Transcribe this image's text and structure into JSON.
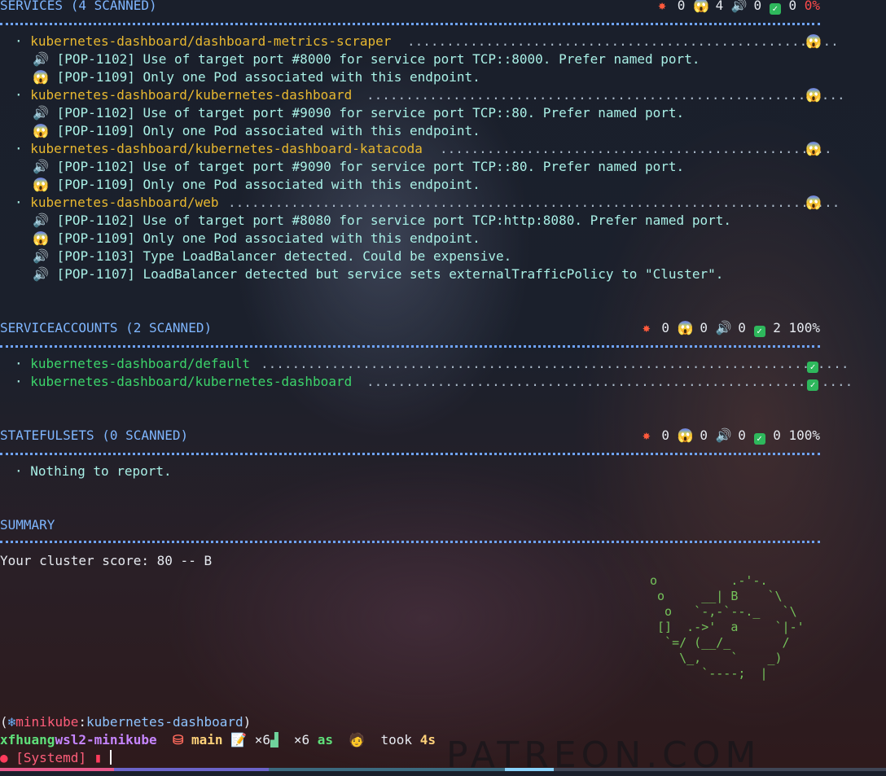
{
  "sections": [
    {
      "title": "SERVICES (4 SCANNED)",
      "stats": {
        "errors": "0",
        "warnings": "4",
        "infos": "0",
        "ok": "0",
        "score": "0%"
      },
      "items": [
        {
          "name": "kubernetes-dashboard/dashboard-metrics-scraper",
          "status": "warning",
          "messages": [
            {
              "level": "info",
              "text": "[POP-1102] Use of target port #8000 for service port TCP::8000. Prefer named port."
            },
            {
              "level": "warning",
              "text": "[POP-1109] Only one Pod associated with this endpoint."
            }
          ]
        },
        {
          "name": "kubernetes-dashboard/kubernetes-dashboard",
          "status": "warning",
          "messages": [
            {
              "level": "info",
              "text": "[POP-1102] Use of target port #9090 for service port TCP::80. Prefer named port."
            },
            {
              "level": "warning",
              "text": "[POP-1109] Only one Pod associated with this endpoint."
            }
          ]
        },
        {
          "name": "kubernetes-dashboard/kubernetes-dashboard-katacoda",
          "status": "warning",
          "messages": [
            {
              "level": "info",
              "text": "[POP-1102] Use of target port #9090 for service port TCP::80. Prefer named port."
            },
            {
              "level": "warning",
              "text": "[POP-1109] Only one Pod associated with this endpoint."
            }
          ]
        },
        {
          "name": "kubernetes-dashboard/web",
          "status": "warning",
          "messages": [
            {
              "level": "info",
              "text": "[POP-1102] Use of target port #8080 for service port TCP:http:8080. Prefer named port."
            },
            {
              "level": "warning",
              "text": "[POP-1109] Only one Pod associated with this endpoint."
            },
            {
              "level": "info",
              "text": "[POP-1103] Type LoadBalancer detected. Could be expensive."
            },
            {
              "level": "info",
              "text": "[POP-1107] LoadBalancer detected but service sets externalTrafficPolicy to \"Cluster\"."
            }
          ]
        }
      ]
    },
    {
      "title": "SERVICEACCOUNTS (2 SCANNED)",
      "stats": {
        "errors": "0",
        "warnings": "0",
        "infos": "0",
        "ok": "2",
        "score": "100%"
      },
      "items": [
        {
          "name": "kubernetes-dashboard/default",
          "status": "ok",
          "messages": []
        },
        {
          "name": "kubernetes-dashboard/kubernetes-dashboard",
          "status": "ok",
          "messages": []
        }
      ]
    },
    {
      "title": "STATEFULSETS (0 SCANNED)",
      "stats": {
        "errors": "0",
        "warnings": "0",
        "infos": "0",
        "ok": "0",
        "score": "100%"
      },
      "empty_text": "Nothing to report."
    }
  ],
  "summary": {
    "title": "SUMMARY",
    "score_text": "Your cluster score: 80 -- B",
    "ascii_art": [
      "o          .-'-.",
      " o     __| B    `\\",
      "  o   `-,-`--._   `\\",
      " []  .->'  a     `|-'",
      "  `=/ (__/_       /",
      "    \\_,    `    _)",
      "       `----;  |"
    ]
  },
  "prompt": {
    "context_open": "(",
    "k8s_icon": "❄",
    "cluster": "minikube",
    "namespace": "kubernetes-dashboard",
    "context_close": ")",
    "user": "xfhuang",
    "host": "wsl2-minikube",
    "branch": "main",
    "count_a": "×6",
    "count_b": "×6",
    "as_label": "as",
    "took_label": "took",
    "took_value": "4s",
    "systemd": "[Systemd]"
  },
  "watermark": "PATREON.COM",
  "colors": {
    "header": "#7fb6ff",
    "warning_name": "#e8b830",
    "ok_name": "#3cd46a",
    "message": "#a9f0e6",
    "accent_red": "#ff4b4b"
  }
}
